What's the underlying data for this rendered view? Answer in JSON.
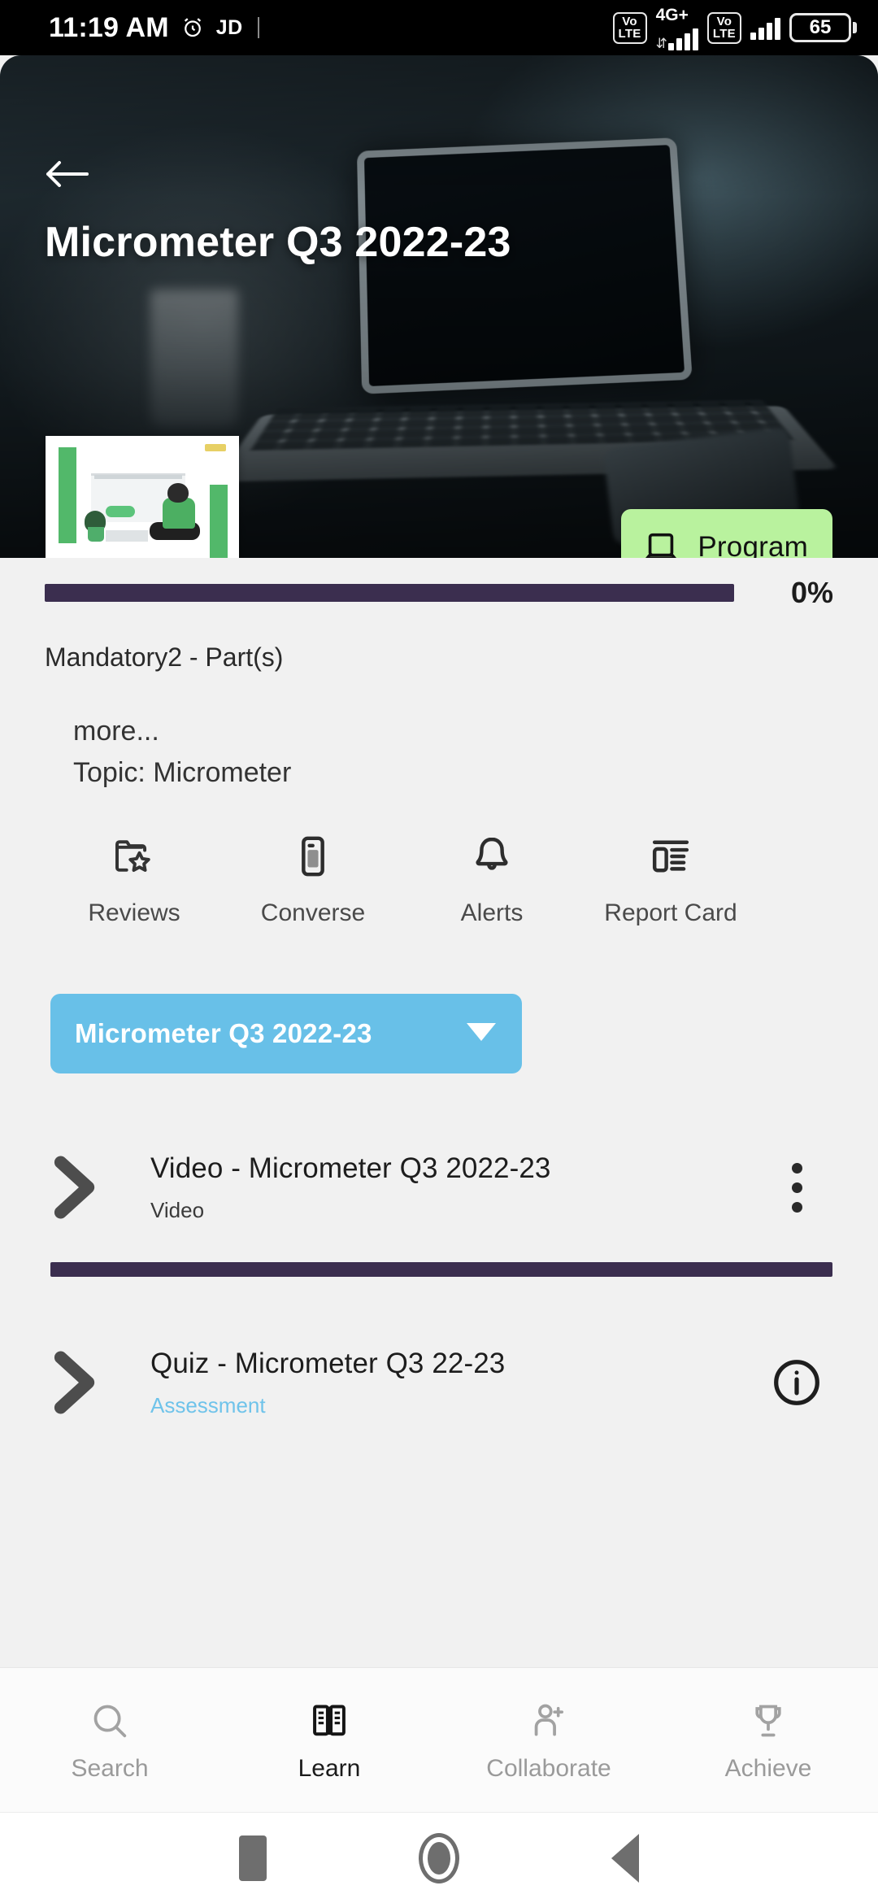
{
  "status_bar": {
    "time": "11:19 AM",
    "alarm_icon": "alarm-clock-icon",
    "app_badge": "JD",
    "network_label": "4G+",
    "sim1_volte_top": "Vo",
    "sim1_volte_bottom": "LTE",
    "sim2_volte_top": "Vo",
    "sim2_volte_bottom": "LTE",
    "battery_percent": "65"
  },
  "hero": {
    "back_icon": "back-arrow-icon",
    "title": "Micrometer Q3 2022-23",
    "thumbnail_name": "course-thumbnail",
    "program_button": {
      "label": "Program",
      "icon": "laptop-icon",
      "bg_color": "#b9f29e"
    }
  },
  "progress": {
    "percent_label": "0%",
    "value": 0,
    "bar_color": "#3b2e4f"
  },
  "meta": {
    "mandatory_line": "Mandatory2 - Part(s)",
    "more_label": "more...",
    "topic_label": "Topic: Micrometer"
  },
  "quick_actions": [
    {
      "label": "Reviews",
      "icon": "folder-star-icon"
    },
    {
      "label": "Converse",
      "icon": "mobile-chat-icon"
    },
    {
      "label": "Alerts",
      "icon": "bell-icon"
    },
    {
      "label": "Report Card",
      "icon": "report-card-icon"
    }
  ],
  "module_selector": {
    "selected": "Micrometer Q3 2022-23",
    "caret_icon": "chevron-down-icon",
    "bg_color": "#68c0e8"
  },
  "content_items": [
    {
      "title": "Video - Micrometer Q3 2022-23",
      "subtitle": "Video",
      "subtitle_kind": "plain",
      "expand_icon": "chevron-right-icon",
      "action_icon": "more-vertical-icon"
    },
    {
      "title": "Quiz - Micrometer Q3 22-23",
      "subtitle": "Assessment",
      "subtitle_kind": "assessment",
      "expand_icon": "chevron-right-icon",
      "action_icon": "info-icon"
    }
  ],
  "bottom_nav": [
    {
      "label": "Search",
      "icon": "search-icon",
      "active": false
    },
    {
      "label": "Learn",
      "icon": "open-book-icon",
      "active": true
    },
    {
      "label": "Collaborate",
      "icon": "person-add-icon",
      "active": false
    },
    {
      "label": "Achieve",
      "icon": "trophy-icon",
      "active": false
    }
  ],
  "android_nav": [
    {
      "icon": "recents-square-icon"
    },
    {
      "icon": "home-circle-icon"
    },
    {
      "icon": "back-triangle-icon"
    }
  ]
}
